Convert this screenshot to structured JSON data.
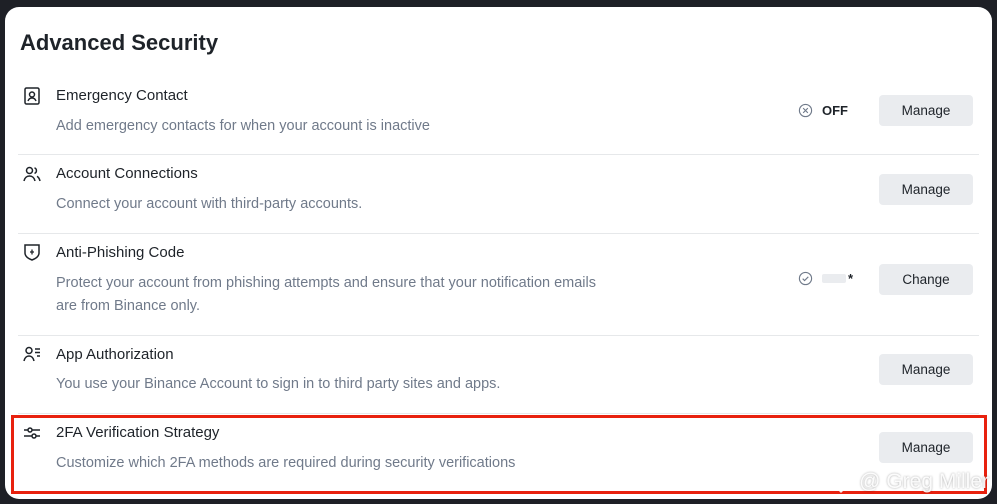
{
  "section": {
    "title": "Advanced Security"
  },
  "rows": [
    {
      "title": "Emergency Contact",
      "desc": "Add emergency contacts for when your account is inactive",
      "status": "OFF",
      "button": "Manage",
      "icon": "contact-card-icon"
    },
    {
      "title": "Account Connections",
      "desc": "Connect your account with third-party accounts.",
      "button": "Manage",
      "icon": "users-icon"
    },
    {
      "title": "Anti-Phishing Code",
      "desc": "Protect your account from phishing attempts and ensure that your notification emails are from Binance only.",
      "status": "*",
      "button": "Change",
      "icon": "shield-icon"
    },
    {
      "title": "App Authorization",
      "desc": "You use your Binance Account to sign in to third party sites and apps.",
      "button": "Manage",
      "icon": "user-list-icon"
    },
    {
      "title": "2FA Verification Strategy",
      "desc": "Customize which 2FA methods are required during security verifications",
      "button": "Manage",
      "icon": "sliders-icon"
    }
  ],
  "watermark": {
    "text": "@ Greg Miller"
  },
  "colors": {
    "highlight": "#e8210e",
    "button_bg": "#eaecef",
    "text_primary": "#1e2329",
    "text_secondary": "#707a8a"
  }
}
